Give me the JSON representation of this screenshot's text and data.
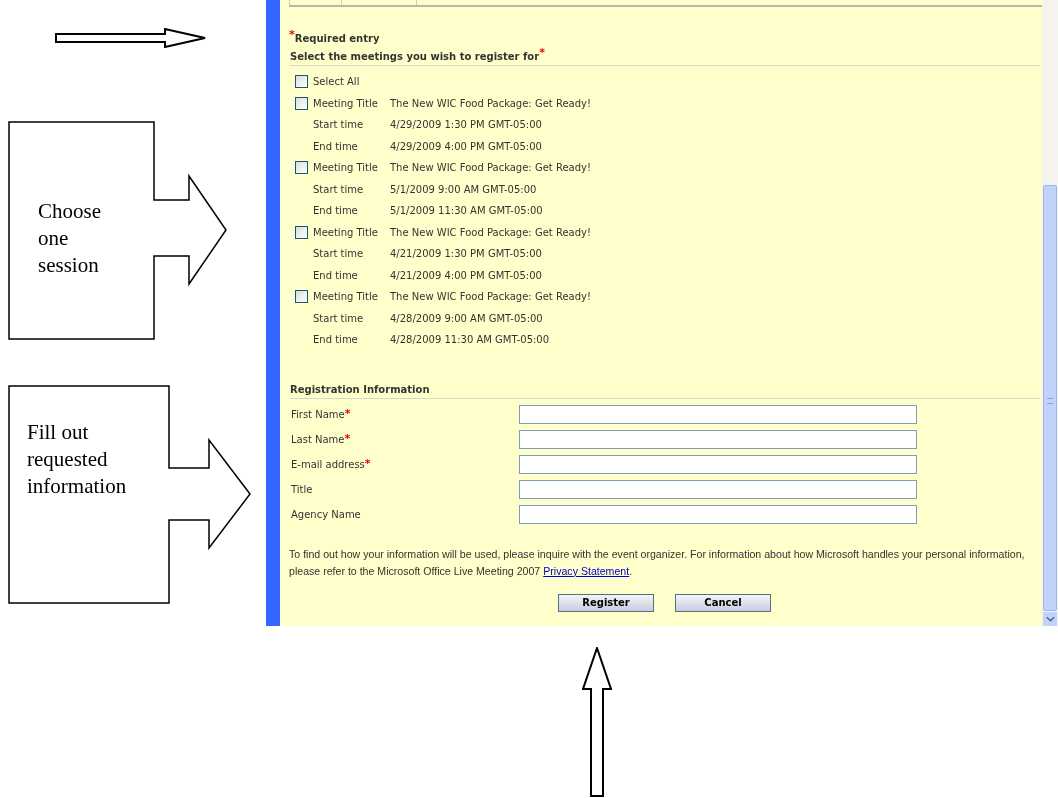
{
  "callouts": [
    {
      "text": "Choose one session"
    },
    {
      "text": "Fill out requested information"
    }
  ],
  "form": {
    "required_mark": "*",
    "required_note": "Required entry",
    "meetings_heading": {
      "text": "Select the meetings you wish to register for",
      "required": true
    },
    "select_all": {
      "label": "Select All",
      "checked": false
    },
    "meetings": [
      {
        "checked": false,
        "rows": [
          {
            "label": "Meeting Title",
            "value": "The New WIC Food Package: Get Ready!"
          },
          {
            "label": "Start time",
            "value": "4/29/2009 1:30 PM GMT-05:00"
          },
          {
            "label": "End time",
            "value": "4/29/2009 4:00 PM GMT-05:00"
          }
        ]
      },
      {
        "checked": false,
        "rows": [
          {
            "label": "Meeting Title",
            "value": "The New WIC Food Package: Get Ready!"
          },
          {
            "label": "Start time",
            "value": "5/1/2009 9:00 AM GMT-05:00"
          },
          {
            "label": "End time",
            "value": "5/1/2009 11:30 AM GMT-05:00"
          }
        ]
      },
      {
        "checked": false,
        "rows": [
          {
            "label": "Meeting Title",
            "value": "The New WIC Food Package: Get Ready!"
          },
          {
            "label": "Start time",
            "value": "4/21/2009 1:30 PM GMT-05:00"
          },
          {
            "label": "End time",
            "value": "4/21/2009 4:00 PM GMT-05:00"
          }
        ]
      },
      {
        "checked": false,
        "rows": [
          {
            "label": "Meeting Title",
            "value": "The New WIC Food Package: Get Ready!"
          },
          {
            "label": "Start time",
            "value": "4/28/2009 9:00 AM GMT-05:00"
          },
          {
            "label": "End time",
            "value": "4/28/2009 11:30 AM GMT-05:00"
          }
        ]
      }
    ],
    "registration_heading": "Registration Information",
    "fields": [
      {
        "label": "First Name",
        "required": true
      },
      {
        "label": "Last Name",
        "required": true
      },
      {
        "label": "E-mail address",
        "required": true
      },
      {
        "label": "Title",
        "required": false
      },
      {
        "label": "Agency Name",
        "required": false
      }
    ],
    "notice": {
      "before": "To find out how your information will be used, please inquire with the event organizer. For information about how Microsoft handles your personal information, please refer to the Microsoft Office Live Meeting 2007 ",
      "link": "Privacy Statement",
      "after": "."
    },
    "buttons": [
      "Register",
      "Cancel"
    ]
  }
}
